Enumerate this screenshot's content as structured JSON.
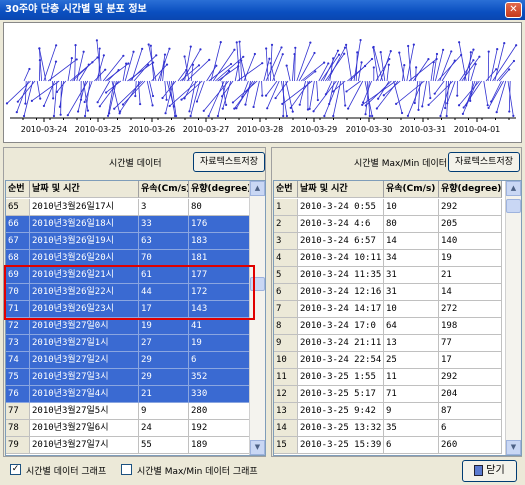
{
  "window": {
    "title": "30주야 단층 시간별 및 분포 정보",
    "close_glyph": "✕"
  },
  "chart": {
    "x_ticks": [
      "2010-03-24",
      "2010-03-25",
      "2010-03-26",
      "2010-03-27",
      "2010-03-28",
      "2010-03-29",
      "2010-03-30",
      "2010-03-31",
      "2010-04-01"
    ],
    "line_color": "#3030d0"
  },
  "left": {
    "title": "시간별 데이터",
    "save_label": "자료텍스트저장",
    "columns": [
      "순번",
      "날짜 및 시간",
      "유속(Cm/s)",
      "유향(degree)"
    ],
    "rows": [
      [
        "65",
        "2010년3월26일17시",
        "3",
        "80"
      ],
      [
        "66",
        "2010년3월26일18시",
        "33",
        "176"
      ],
      [
        "67",
        "2010년3월26일19시",
        "63",
        "183"
      ],
      [
        "68",
        "2010년3월26일20시",
        "70",
        "181"
      ],
      [
        "69",
        "2010년3월26일21시",
        "61",
        "177"
      ],
      [
        "70",
        "2010년3월26일22시",
        "44",
        "172"
      ],
      [
        "71",
        "2010년3월26일23시",
        "17",
        "143"
      ],
      [
        "72",
        "2010년3월27일0시",
        "19",
        "41"
      ],
      [
        "73",
        "2010년3월27일1시",
        "27",
        "19"
      ],
      [
        "74",
        "2010년3월27일2시",
        "29",
        "6"
      ],
      [
        "75",
        "2010년3월27일3시",
        "29",
        "352"
      ],
      [
        "76",
        "2010년3월27일4시",
        "21",
        "330"
      ],
      [
        "77",
        "2010년3월27일5시",
        "9",
        "280"
      ],
      [
        "78",
        "2010년3월27일6시",
        "24",
        "192"
      ],
      [
        "79",
        "2010년3월27일7시",
        "55",
        "189"
      ]
    ],
    "selected": [
      1,
      2,
      3,
      4,
      5,
      6,
      7,
      8,
      9,
      10,
      11
    ]
  },
  "right": {
    "title": "시간별 Max/Min 데이터",
    "save_label": "자료텍스트저장",
    "columns": [
      "순번",
      "날짜 및 시간",
      "유속(Cm/s)",
      "유향(degree)"
    ],
    "rows": [
      [
        "1",
        "2010-3-24  0:55",
        "10",
        "292"
      ],
      [
        "2",
        "2010-3-24  4:6",
        "80",
        "205"
      ],
      [
        "3",
        "2010-3-24  6:57",
        "14",
        "140"
      ],
      [
        "4",
        "2010-3-24  10:11",
        "34",
        "19"
      ],
      [
        "5",
        "2010-3-24  11:35",
        "31",
        "21"
      ],
      [
        "6",
        "2010-3-24  12:16",
        "31",
        "14"
      ],
      [
        "7",
        "2010-3-24  14:17",
        "10",
        "272"
      ],
      [
        "8",
        "2010-3-24  17:0",
        "64",
        "198"
      ],
      [
        "9",
        "2010-3-24  21:11",
        "13",
        "77"
      ],
      [
        "10",
        "2010-3-24  22:54",
        "25",
        "17"
      ],
      [
        "11",
        "2010-3-25  1:55",
        "11",
        "292"
      ],
      [
        "12",
        "2010-3-25  5:17",
        "71",
        "204"
      ],
      [
        "13",
        "2010-3-25  9:42",
        "9",
        "87"
      ],
      [
        "14",
        "2010-3-25  13:32",
        "35",
        "6"
      ],
      [
        "15",
        "2010-3-25  15:39",
        "6",
        "260"
      ]
    ]
  },
  "bottom": {
    "check1_label": "시간별 데이터 그래프",
    "check1_mark": "✓",
    "check2_label": "시간별 Max/Min 데이터 그래프",
    "close_label": "닫기"
  }
}
